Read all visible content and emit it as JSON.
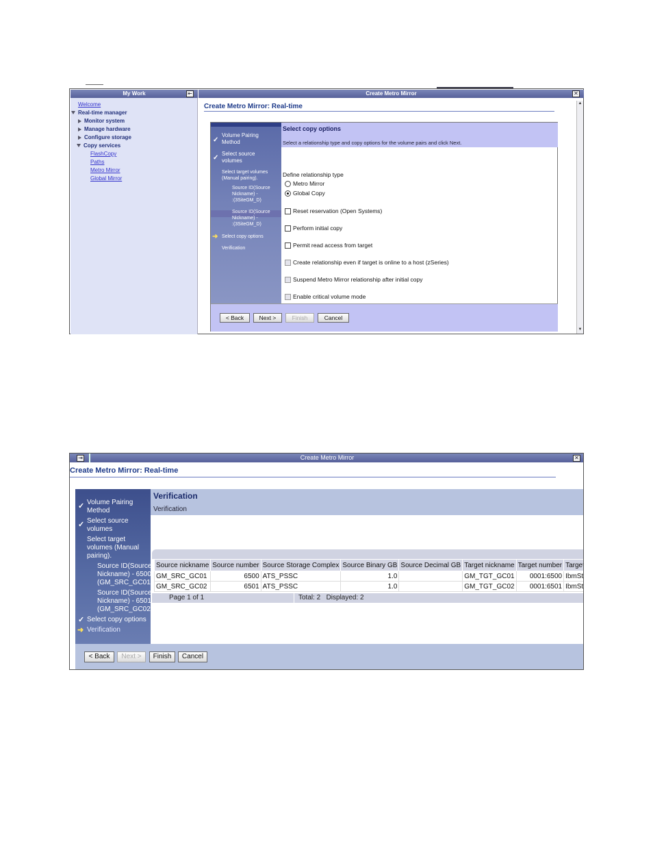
{
  "screenshot1": {
    "my_work_title": "My Work",
    "window_title": "Create Metro Mirror",
    "nav": {
      "welcome": "Welcome",
      "realtime_manager": "Real-time manager",
      "monitor_system": "Monitor system",
      "manage_hardware": "Manage hardware",
      "configure_storage": "Configure storage",
      "copy_services": "Copy services",
      "flashcopy": "FlashCopy",
      "paths": "Paths",
      "metro_mirror": "Metro Mirror",
      "global_mirror": "Global Mirror"
    },
    "content_title": "Create Metro Mirror: Real-time",
    "steps": {
      "volume_pairing": [
        "Volume Pairing",
        "Method"
      ],
      "select_source": [
        "Select source",
        "volumes"
      ],
      "select_target": [
        "Select target volumes",
        "(Manual pairing)."
      ],
      "source_id_1": [
        "Source ID(Source",
        "Nickname) -",
        ":(3SiteGM_D)"
      ],
      "source_id_2": [
        "Source ID(Source",
        "Nickname) -",
        ":(3SiteGM_D)"
      ],
      "select_copy_options": "Select copy options",
      "verification": "Verification"
    },
    "panel_title": "Select copy options",
    "panel_description": "Select a relationship type and copy options for the volume pairs and click Next.",
    "define_relationship_type": "Define relationship type",
    "radio_metro_mirror": "Metro Mirror",
    "radio_global_copy": "Global Copy",
    "selected_relationship": "Global Copy",
    "options": {
      "reset_reservation": "Reset reservation (Open Systems)",
      "perform_initial_copy": "Perform initial copy",
      "permit_read_access": "Permit read access from target",
      "create_relationship_online": "Create relationship even if target is online to a host (zSeries)",
      "suspend_metro_mirror": "Suspend Metro Mirror relationship after initial copy",
      "enable_critical_volume": "Enable critical volume mode"
    },
    "buttons": {
      "back": "< Back",
      "next": "Next >",
      "finish": "Finish",
      "cancel": "Cancel"
    }
  },
  "screenshot2": {
    "window_title": "Create Metro Mirror",
    "content_title": "Create Metro Mirror: Real-time",
    "steps": {
      "volume_pairing": [
        "Volume Pairing",
        "Method"
      ],
      "select_source": [
        "Select source",
        "volumes"
      ],
      "select_target": [
        "Select target",
        "volumes (Manual",
        "pairing)."
      ],
      "source_id_1": [
        "Source ID(Source",
        "Nickname) - 6500",
        "(GM_SRC_GC01)"
      ],
      "source_id_2": [
        "Source ID(Source",
        "Nickname) - 6501",
        "(GM_SRC_GC02)"
      ],
      "select_copy_options": "Select copy options",
      "verification": "Verification"
    },
    "panel_title": "Verification",
    "panel_subtitle": "Verification",
    "table": {
      "columns": [
        "Source nickname",
        "Source number",
        "Source Storage Complex",
        "Source Binary GB",
        "Source Decimal GB",
        "Target nickname",
        "Target number",
        "Target S"
      ],
      "rows": [
        [
          "GM_SRC_GC01",
          "6500",
          "ATS_PSSC",
          "1.0",
          "",
          "GM_TGT_GC01",
          "0001:6500",
          "IbmStor"
        ],
        [
          "GM_SRC_GC02",
          "6501",
          "ATS_PSSC",
          "1.0",
          "",
          "GM_TGT_GC02",
          "0001:6501",
          "IbmStor"
        ]
      ],
      "page_info": "Page 1 of 1",
      "totals": "Total: 2   Displayed: 2"
    },
    "buttons": {
      "back": "< Back",
      "next": "Next >",
      "finish": "Finish",
      "cancel": "Cancel"
    }
  }
}
